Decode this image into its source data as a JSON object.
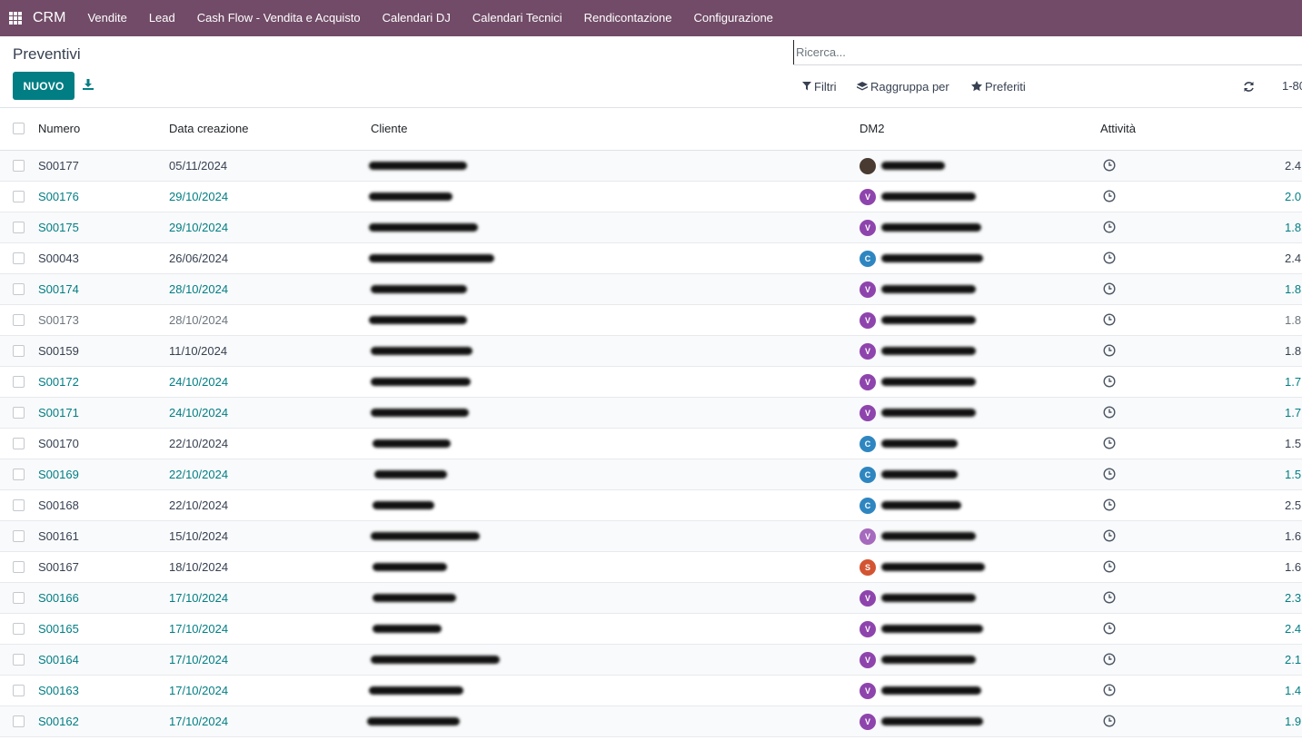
{
  "navbar": {
    "brand": "CRM",
    "items": [
      "Vendite",
      "Lead",
      "Cash Flow - Vendita e Acquisto",
      "Calendari DJ",
      "Calendari Tecnici",
      "Rendicontazione",
      "Configurazione"
    ]
  },
  "control_panel": {
    "title": "Preventivi",
    "new_button": "NUOVO",
    "search_placeholder": "Ricerca...",
    "filters_label": "Filtri",
    "groupby_label": "Raggruppa per",
    "favorites_label": "Preferiti",
    "pager": "1-80"
  },
  "list": {
    "columns": {
      "number": "Numero",
      "date": "Data creazione",
      "client": "Cliente",
      "dm2": "DM2",
      "activity": "Attività"
    },
    "rows": [
      {
        "number": "S00177",
        "date": "05/11/2024",
        "amount": "2.4",
        "style": "dark",
        "avatar": "",
        "avatar_color": "#4a3b32"
      },
      {
        "number": "S00176",
        "date": "29/10/2024",
        "amount": "2.0",
        "style": "teal",
        "avatar": "V",
        "avatar_color": "#8e44ad"
      },
      {
        "number": "S00175",
        "date": "29/10/2024",
        "amount": "1.8",
        "style": "teal",
        "avatar": "V",
        "avatar_color": "#8e44ad"
      },
      {
        "number": "S00043",
        "date": "26/06/2024",
        "amount": "2.4",
        "style": "dark",
        "avatar": "C",
        "avatar_color": "#2e86c1"
      },
      {
        "number": "S00174",
        "date": "28/10/2024",
        "amount": "1.8",
        "style": "teal",
        "avatar": "V",
        "avatar_color": "#8e44ad"
      },
      {
        "number": "S00173",
        "date": "28/10/2024",
        "amount": "1.8",
        "style": "muted",
        "avatar": "V",
        "avatar_color": "#8e44ad"
      },
      {
        "number": "S00159",
        "date": "11/10/2024",
        "amount": "1.8",
        "style": "dark",
        "avatar": "V",
        "avatar_color": "#8e44ad"
      },
      {
        "number": "S00172",
        "date": "24/10/2024",
        "amount": "1.7",
        "style": "teal",
        "avatar": "V",
        "avatar_color": "#8e44ad"
      },
      {
        "number": "S00171",
        "date": "24/10/2024",
        "amount": "1.7",
        "style": "teal",
        "avatar": "V",
        "avatar_color": "#8e44ad"
      },
      {
        "number": "S00170",
        "date": "22/10/2024",
        "amount": "1.5",
        "style": "dark",
        "avatar": "C",
        "avatar_color": "#2e86c1"
      },
      {
        "number": "S00169",
        "date": "22/10/2024",
        "amount": "1.5",
        "style": "teal",
        "avatar": "C",
        "avatar_color": "#2e86c1"
      },
      {
        "number": "S00168",
        "date": "22/10/2024",
        "amount": "2.5",
        "style": "dark",
        "avatar": "C",
        "avatar_color": "#2e86c1"
      },
      {
        "number": "S00161",
        "date": "15/10/2024",
        "amount": "1.6",
        "style": "dark",
        "avatar": "V",
        "avatar_color": "#a569bd"
      },
      {
        "number": "S00167",
        "date": "18/10/2024",
        "amount": "1.6",
        "style": "dark",
        "avatar": "S",
        "avatar_color": "#d35432"
      },
      {
        "number": "S00166",
        "date": "17/10/2024",
        "amount": "2.3",
        "style": "teal",
        "avatar": "V",
        "avatar_color": "#8e44ad"
      },
      {
        "number": "S00165",
        "date": "17/10/2024",
        "amount": "2.4",
        "style": "teal",
        "avatar": "V",
        "avatar_color": "#8e44ad"
      },
      {
        "number": "S00164",
        "date": "17/10/2024",
        "amount": "2.1",
        "style": "teal",
        "avatar": "V",
        "avatar_color": "#8e44ad"
      },
      {
        "number": "S00163",
        "date": "17/10/2024",
        "amount": "1.4",
        "style": "teal",
        "avatar": "V",
        "avatar_color": "#8e44ad"
      },
      {
        "number": "S00162",
        "date": "17/10/2024",
        "amount": "1.9",
        "style": "teal",
        "avatar": "V",
        "avatar_color": "#8e44ad"
      }
    ]
  },
  "colors": {
    "navbar": "#714b67",
    "primary": "#017e84",
    "link": "#017e84"
  }
}
